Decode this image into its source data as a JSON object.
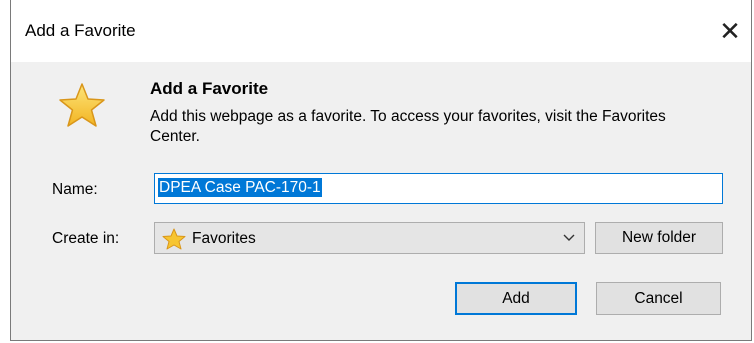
{
  "dialog": {
    "title": "Add a Favorite",
    "close_glyph": "✕"
  },
  "header": {
    "icon": "star-icon",
    "title": "Add a Favorite",
    "description": "Add this webpage as a favorite. To access your favorites, visit the Favorites Center."
  },
  "form": {
    "name_label": "Name:",
    "name_value": "DPEA Case PAC-170-1",
    "create_in_label": "Create in:",
    "create_in_value": "Favorites",
    "new_folder_label": "New folder"
  },
  "buttons": {
    "add_label": "Add",
    "cancel_label": "Cancel"
  },
  "colors": {
    "accent": "#0078d7",
    "star": "#f7c531"
  }
}
